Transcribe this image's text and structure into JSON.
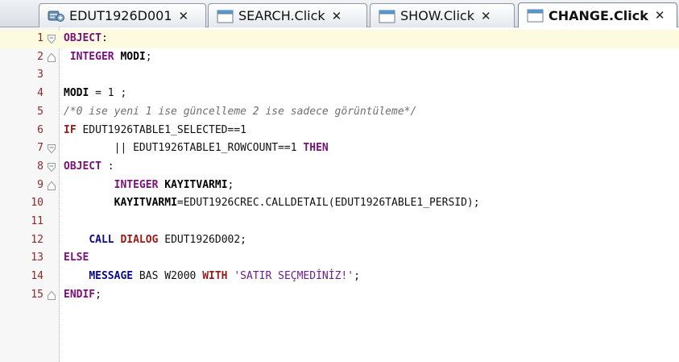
{
  "tabs": [
    {
      "label": "EDUT1926D001",
      "icon": "form-icon",
      "active": false
    },
    {
      "label": "SEARCH.Click",
      "icon": "window-icon",
      "active": false
    },
    {
      "label": "SHOW.Click",
      "icon": "window-icon",
      "active": false
    },
    {
      "label": "CHANGE.Click",
      "icon": "window-icon",
      "active": true
    }
  ],
  "tab_close_glyph": "✕",
  "colors": {
    "keyword": "#7a0f7a",
    "keyword_red": "#9a1a1a",
    "keyword_blue": "#0a0a8a",
    "line_number": "#8a2a2a",
    "comment": "#6f6f6f",
    "current_line": "#fcfbe0"
  },
  "editor": {
    "current_line": 1,
    "lines": [
      {
        "n": "1",
        "fold": "open",
        "tokens": [
          {
            "t": "OBJECT",
            "c": "kw"
          },
          {
            "t": ":",
            "c": "plain"
          }
        ]
      },
      {
        "n": "2",
        "fold": "end",
        "tokens": [
          {
            "t": " ",
            "c": "plain"
          },
          {
            "t": "INTEGER",
            "c": "kw"
          },
          {
            "t": " ",
            "c": "plain"
          },
          {
            "t": "MODI",
            "c": "ident"
          },
          {
            "t": ";",
            "c": "plain"
          }
        ]
      },
      {
        "n": "3",
        "fold": "",
        "tokens": []
      },
      {
        "n": "4",
        "fold": "",
        "tokens": [
          {
            "t": "MODI",
            "c": "ident"
          },
          {
            "t": " = 1 ;",
            "c": "plain"
          }
        ]
      },
      {
        "n": "5",
        "fold": "",
        "tokens": [
          {
            "t": "/*0 ise yeni 1 ise güncelleme 2 ise sadece görüntüleme*/",
            "c": "comment"
          }
        ]
      },
      {
        "n": "6",
        "fold": "",
        "tokens": [
          {
            "t": "IF",
            "c": "kwr"
          },
          {
            "t": " EDUT1926TABLE1_SELECTED==1",
            "c": "plain"
          }
        ]
      },
      {
        "n": "7",
        "fold": "open",
        "tokens": [
          {
            "t": "        || EDUT1926TABLE1_ROWCOUNT==1 ",
            "c": "plain"
          },
          {
            "t": "THEN",
            "c": "kw"
          }
        ]
      },
      {
        "n": "8",
        "fold": "open",
        "tokens": [
          {
            "t": "OBJECT",
            "c": "kw"
          },
          {
            "t": " :",
            "c": "plain"
          }
        ]
      },
      {
        "n": "9",
        "fold": "end",
        "tokens": [
          {
            "t": "        ",
            "c": "plain"
          },
          {
            "t": "INTEGER",
            "c": "kw"
          },
          {
            "t": " ",
            "c": "plain"
          },
          {
            "t": "KAYITVARMI",
            "c": "ident"
          },
          {
            "t": ";",
            "c": "plain"
          }
        ]
      },
      {
        "n": "10",
        "fold": "",
        "tokens": [
          {
            "t": "        ",
            "c": "plain"
          },
          {
            "t": "KAYITVARMI",
            "c": "ident"
          },
          {
            "t": "=EDUT1926CREC.CALLDETAIL(EDUT1926TABLE1_PERSID);",
            "c": "plain"
          }
        ]
      },
      {
        "n": "11",
        "fold": "",
        "tokens": []
      },
      {
        "n": "12",
        "fold": "",
        "tokens": [
          {
            "t": "    ",
            "c": "plain"
          },
          {
            "t": "CALL",
            "c": "kwb"
          },
          {
            "t": " ",
            "c": "plain"
          },
          {
            "t": "DIALOG",
            "c": "kwr"
          },
          {
            "t": " EDUT1926D002;",
            "c": "plain"
          }
        ]
      },
      {
        "n": "13",
        "fold": "",
        "tokens": [
          {
            "t": "ELSE",
            "c": "kw"
          }
        ]
      },
      {
        "n": "14",
        "fold": "",
        "tokens": [
          {
            "t": "    ",
            "c": "plain"
          },
          {
            "t": "MESSAGE",
            "c": "kwb"
          },
          {
            "t": " BAS W2000 ",
            "c": "plain"
          },
          {
            "t": "WITH",
            "c": "kwr"
          },
          {
            "t": " ",
            "c": "plain"
          },
          {
            "t": "'SATIR SEÇMEDİNİZ!'",
            "c": "str"
          },
          {
            "t": ";",
            "c": "plain"
          }
        ]
      },
      {
        "n": "15",
        "fold": "end",
        "tokens": [
          {
            "t": "ENDIF",
            "c": "kw"
          },
          {
            "t": ";",
            "c": "plain"
          }
        ]
      }
    ]
  }
}
